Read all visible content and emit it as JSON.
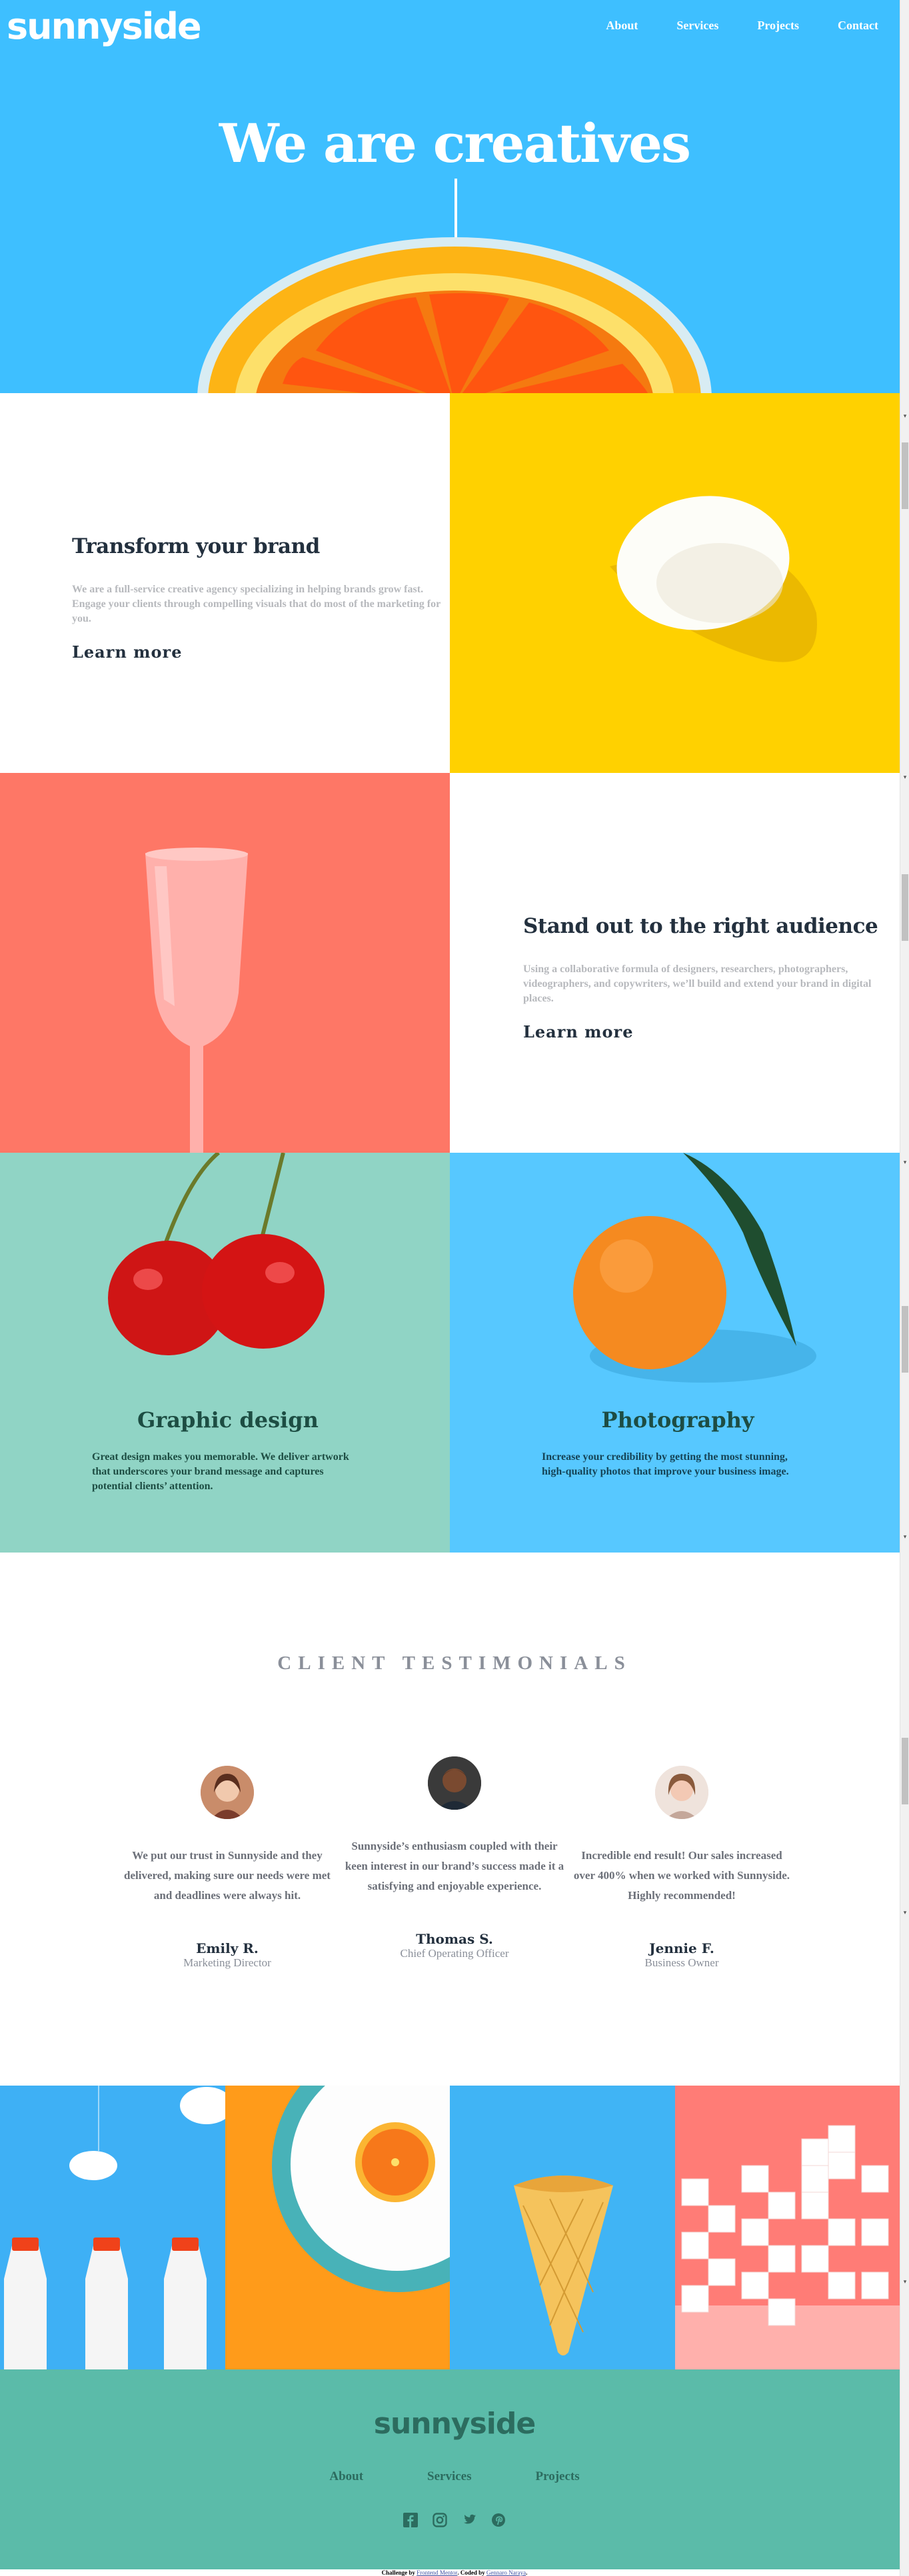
{
  "header": {
    "logo": "sunnyside",
    "nav": [
      "About",
      "Services",
      "Projects",
      "Contact"
    ]
  },
  "hero": {
    "title": "We are creatives",
    "arrow_icon": "arrow-down-icon"
  },
  "features": [
    {
      "title": "Transform your brand",
      "text": "We are a full-service creative agency specializing in helping brands grow fast. Engage your clients through compelling visuals that do most of the marketing for you.",
      "link": "Learn more"
    },
    {
      "title": "Stand out to the right audience",
      "text": "Using a collaborative formula of designers, researchers, photographers, videographers, and copywriters, we’ll build and extend your brand in digital places.",
      "link": "Learn more"
    }
  ],
  "services": [
    {
      "title": "Graphic design",
      "text": "Great design makes you memorable. We deliver artwork that underscores your brand message and captures potential clients’ attention."
    },
    {
      "title": "Photography",
      "text": "Increase your credibility by getting the most stunning, high-quality photos that improve your business image."
    }
  ],
  "testimonials": {
    "heading": "CLIENT TESTIMONIALS",
    "items": [
      {
        "quote": "We put our trust in Sunnyside and they delivered, making sure our needs were met and deadlines were always hit.",
        "name": "Emily R.",
        "role": "Marketing Director"
      },
      {
        "quote": "Sunnyside’s enthusiasm coupled with their keen interest in our brand’s success made it a satisfying and enjoyable experience.",
        "name": "Thomas S.",
        "role": "Chief Operating Officer"
      },
      {
        "quote": "Incredible end result! Our sales increased over 400% when we worked with Sunnyside. Highly recommended!",
        "name": "Jennie F.",
        "role": "Business Owner"
      }
    ]
  },
  "footer": {
    "logo": "sunnyside",
    "nav": [
      "About",
      "Services",
      "Projects"
    ],
    "social_icons": [
      "facebook-icon",
      "instagram-icon",
      "twitter-icon",
      "pinterest-icon"
    ]
  },
  "attribution": {
    "prefix": "Challenge by ",
    "link1": "Frontend Mentor",
    "middle": ". Coded by ",
    "link2": "Gennaro Naraya",
    "suffix": "."
  },
  "colors": {
    "hero_blue": "#3ebfff",
    "yellow": "#ffd100",
    "pink": "#fe7766",
    "mint": "#90d4c5",
    "sky": "#57c8ff",
    "footer_green": "#5bbba9",
    "dark_text": "#23303e",
    "gray_text": "#b7b9bd"
  }
}
